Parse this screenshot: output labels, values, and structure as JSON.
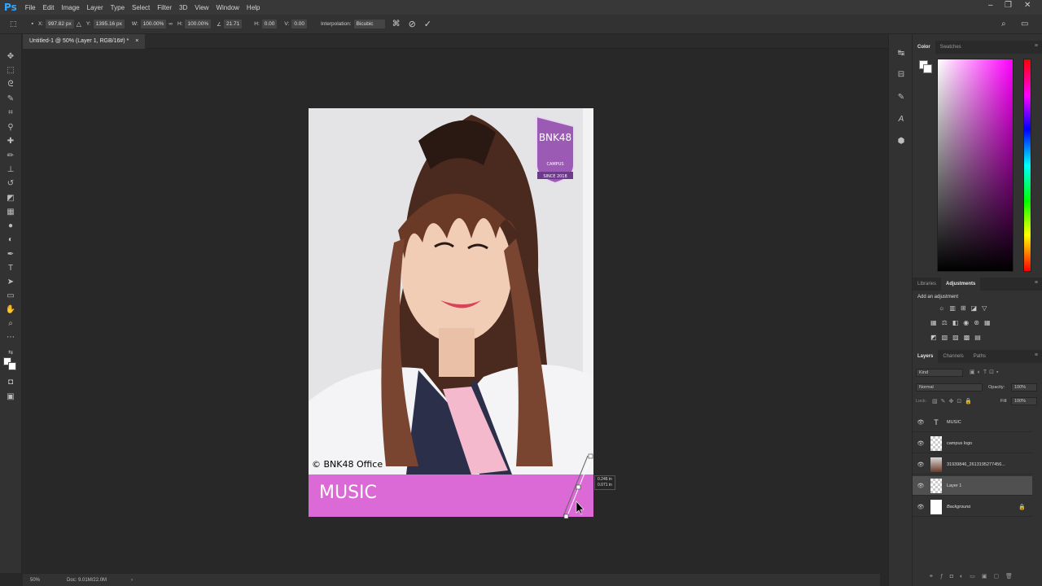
{
  "app": {
    "logo": "Ps"
  },
  "menu": [
    "File",
    "Edit",
    "Image",
    "Layer",
    "Type",
    "Select",
    "Filter",
    "3D",
    "View",
    "Window",
    "Help"
  ],
  "window_controls": {
    "minimize": "–",
    "restore": "❐",
    "close": "✕"
  },
  "options": {
    "x_label": "X:",
    "x_value": "997.82 px",
    "y_label": "Y:",
    "y_value": "1395.16 px",
    "w_label": "W:",
    "w_value": "100.00%",
    "h_label": "H:",
    "h_value": "100.00%",
    "angle_value": "21.71",
    "hskew_label": "H:",
    "hskew_value": "0.00",
    "vskew_label": "V:",
    "vskew_value": "0.00",
    "interp_label": "Interpolation:",
    "interp_value": "Bicubic"
  },
  "document": {
    "tab_title": "Untitled-1 @ 50% (Layer 1, RGB/16#) *",
    "tab_close": "×"
  },
  "canvas": {
    "banner_text": "MUSIC",
    "copyright": "© BNK48 Office",
    "tooltip_line1": "0.246 in",
    "tooltip_line2": "0.071 in",
    "logo_text": "BNK48",
    "logo_sub1": "CAMPUS",
    "logo_sub2": "SINCE 2018"
  },
  "status": {
    "zoom": "50%",
    "doc": "Doc: 9.01M/22.0M"
  },
  "color_panel": {
    "tabs": [
      "Color",
      "Swatches"
    ]
  },
  "adjust_panel": {
    "tabs": [
      "Libraries",
      "Adjustments"
    ],
    "hint": "Add an adjustment"
  },
  "layers_panel": {
    "tabs": [
      "Layers",
      "Channels",
      "Paths"
    ],
    "kind": "Kind",
    "blend_mode": "Normal",
    "opacity_label": "Opacity:",
    "opacity_value": "100%",
    "lock_label": "Lock:",
    "fill_label": "Fill:",
    "fill_value": "100%",
    "layers": [
      {
        "name": "MUSIC",
        "type": "text"
      },
      {
        "name": "campus logo",
        "type": "image"
      },
      {
        "name": "31939846_2613195277456...",
        "type": "photo"
      },
      {
        "name": "Layer 1",
        "type": "pixel",
        "selected": true
      },
      {
        "name": "Background",
        "type": "background",
        "locked": true
      }
    ]
  },
  "colors": {
    "accent_banner": "#dc6ad6",
    "ps_blue": "#31a8ff",
    "logo_purple": "#9b5bb5"
  }
}
